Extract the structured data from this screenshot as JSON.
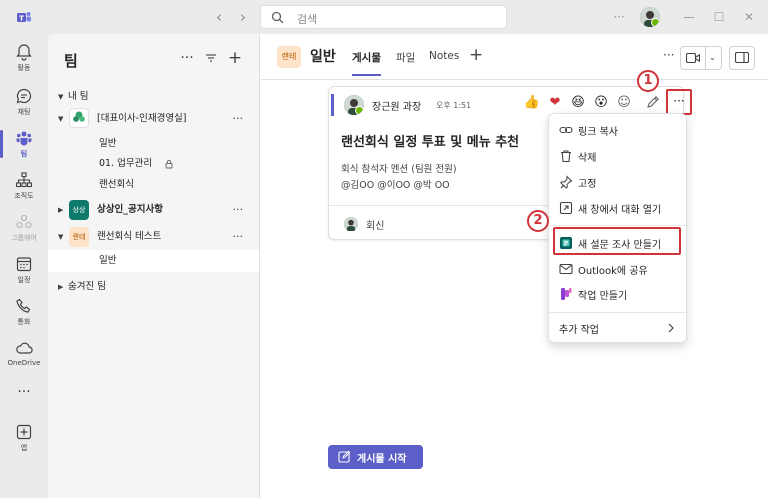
{
  "titlebar": {
    "search_placeholder": "검색"
  },
  "rail": {
    "items": [
      {
        "label": "활동",
        "icon": "bell-icon"
      },
      {
        "label": "채팅",
        "icon": "chat-icon"
      },
      {
        "label": "팀",
        "icon": "teams-icon"
      },
      {
        "label": "조직도",
        "icon": "org-chart-icon"
      },
      {
        "label": "그룹웨어",
        "icon": "groupware-icon"
      },
      {
        "label": "일정",
        "icon": "calendar-icon"
      },
      {
        "label": "통화",
        "icon": "phone-icon"
      },
      {
        "label": "OneDrive",
        "icon": "cloud-icon"
      },
      {
        "label": "앱",
        "icon": "add-app-icon"
      }
    ]
  },
  "panel": {
    "title": "팀",
    "my_teams_label": "내 팀",
    "team1": {
      "name": "[대표이사-인재경영실]",
      "avatar_text": "상상인",
      "channels": [
        "일반",
        "01. 업무관리",
        "랜선회식"
      ]
    },
    "team2": {
      "name": "상상인_공지사항",
      "avatar_text": "상상"
    },
    "team3": {
      "name": "랜선회식 테스트",
      "avatar_text": "랜테",
      "channels": [
        "일반"
      ]
    },
    "hidden_teams_label": "숨겨진 팀"
  },
  "channel_header": {
    "badge": "랜테",
    "name": "일반",
    "tabs": [
      "게시물",
      "파일",
      "Notes"
    ],
    "active_tab": "게시물"
  },
  "post": {
    "author": "장근원 과장",
    "time": "오후 1:51",
    "title": "랜선회식 일정 투표 및 메뉴 추천",
    "line1": "회식 참석자 멘션 (팀원 전원)",
    "line2": "@김OO @이OO @박 OO",
    "reply_label": "회신",
    "reactions": [
      "👍",
      "❤",
      "😆",
      "😮",
      "☺"
    ]
  },
  "callouts": {
    "one": "1",
    "two": "2"
  },
  "context_menu": {
    "items": [
      {
        "label": "링크 복사",
        "icon": "link-icon"
      },
      {
        "label": "삭제",
        "icon": "trash-icon"
      },
      {
        "label": "고정",
        "icon": "pin-icon"
      },
      {
        "label": "새 창에서 대화 열기",
        "icon": "pop-out-icon"
      },
      {
        "label": "새 설문 조사 만들기",
        "icon": "forms-icon"
      },
      {
        "label": "Outlook에 공유",
        "icon": "mail-icon"
      },
      {
        "label": "작업 만들기",
        "icon": "planner-icon"
      },
      {
        "label": "추가 작업",
        "icon": "chevron-right-icon"
      }
    ]
  },
  "start_post_button": "게시물 시작",
  "colors": {
    "accent": "#5b5fc7",
    "highlight": "#d13438",
    "presence": "#6bb700"
  }
}
